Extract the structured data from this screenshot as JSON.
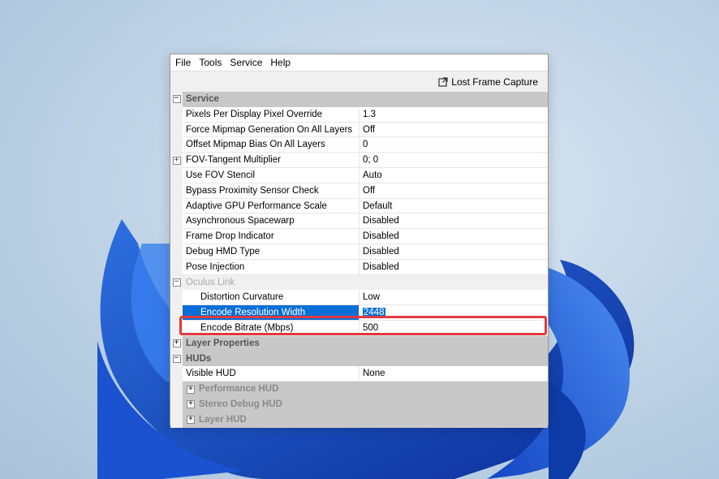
{
  "menu": [
    "File",
    "Tools",
    "Service",
    "Help"
  ],
  "toolbar": {
    "lost_frame_capture": "Lost Frame Capture"
  },
  "categories": {
    "service": "Service",
    "oculus_link": "Oculus Link",
    "layer_properties": "Layer Properties",
    "huds": "HUDs"
  },
  "service_rows": [
    {
      "name": "Pixels Per Display Pixel Override",
      "value": "1.3"
    },
    {
      "name": "Force Mipmap Generation On All Layers",
      "value": "Off"
    },
    {
      "name": "Offset Mipmap Bias On All Layers",
      "value": "0"
    },
    {
      "name": "FOV-Tangent Multiplier",
      "value": "0; 0"
    },
    {
      "name": "Use FOV Stencil",
      "value": "Auto"
    },
    {
      "name": "Bypass Proximity Sensor Check",
      "value": "Off"
    },
    {
      "name": "Adaptive GPU Performance Scale",
      "value": "Default"
    },
    {
      "name": "Asynchronous Spacewarp",
      "value": "Disabled"
    },
    {
      "name": "Frame Drop Indicator",
      "value": "Disabled"
    },
    {
      "name": "Debug HMD Type",
      "value": "Disabled"
    },
    {
      "name": "Pose Injection",
      "value": "Disabled"
    }
  ],
  "oculus_link_rows": [
    {
      "name": "Distortion Curvature",
      "value": "Low"
    },
    {
      "name": "Encode Resolution Width",
      "value": "2448"
    },
    {
      "name": "Encode Bitrate (Mbps)",
      "value": "500"
    }
  ],
  "hud_rows": [
    {
      "name": "Visible HUD",
      "value": "None"
    }
  ],
  "hud_subs": [
    "Performance HUD",
    "Stereo Debug HUD",
    "Layer HUD"
  ],
  "colors": {
    "selection": "#0a6fd6",
    "highlight_box": "#e0393f"
  }
}
